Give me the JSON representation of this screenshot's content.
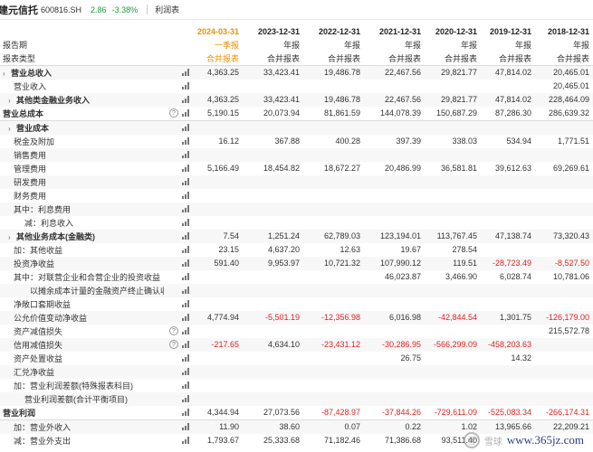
{
  "header": {
    "company_name": "建元信托",
    "stock_code": "600816.SH",
    "price": "2.86",
    "change_pct": "-3.38%",
    "tab": "利润表"
  },
  "columns": {
    "dates": [
      "2024-03-31",
      "2023-12-31",
      "2022-12-31",
      "2021-12-31",
      "2020-12-31",
      "2019-12-31",
      "2018-12-31"
    ],
    "report_periods": [
      "一季报",
      "年报",
      "年报",
      "年报",
      "年报",
      "年报",
      "年报"
    ],
    "report_types": [
      "合并报表",
      "合并报表",
      "合并报表",
      "合并报表",
      "合并报表",
      "合并报表",
      "合并报表"
    ]
  },
  "labels": {
    "report_period": "报告期",
    "report_type": "报表类型"
  },
  "rows": [
    {
      "label": "营业总收入",
      "indent": 0,
      "expand": true,
      "bold": true,
      "help": false,
      "values": [
        "4,363.25",
        "33,423.41",
        "19,486.78",
        "22,467.56",
        "29,821.77",
        "47,814.02",
        "20,465.01"
      ]
    },
    {
      "label": "营业收入",
      "indent": 2,
      "expand": false,
      "bold": false,
      "help": false,
      "values": [
        "",
        "",
        "",
        "",
        "",
        "",
        "20,465.01"
      ]
    },
    {
      "label": "其他类金融业务收入",
      "indent": 1,
      "expand": true,
      "bold": true,
      "help": false,
      "values": [
        "4,363.25",
        "33,423.41",
        "19,486.78",
        "22,467.56",
        "29,821.77",
        "47,814.02",
        "228,464.09"
      ]
    },
    {
      "label": "营业总成本",
      "indent": 0,
      "expand": false,
      "bold": true,
      "help": true,
      "sep": true,
      "values": [
        "5,190.15",
        "20,073.94",
        "81,861.59",
        "144,078.39",
        "150,687.29",
        "87,286.30",
        "286,639.32"
      ]
    },
    {
      "label": "营业成本",
      "indent": 1,
      "expand": true,
      "bold": true,
      "help": false,
      "values": [
        "",
        "",
        "",
        "",
        "",
        "",
        ""
      ]
    },
    {
      "label": "税金及附加",
      "indent": 2,
      "expand": false,
      "bold": false,
      "help": false,
      "values": [
        "16.12",
        "367.88",
        "400.28",
        "397.39",
        "338.03",
        "534.94",
        "1,771.51"
      ]
    },
    {
      "label": "销售费用",
      "indent": 2,
      "expand": false,
      "bold": false,
      "help": false,
      "values": [
        "",
        "",
        "",
        "",
        "",
        "",
        ""
      ]
    },
    {
      "label": "管理费用",
      "indent": 2,
      "expand": false,
      "bold": false,
      "help": false,
      "values": [
        "5,166.49",
        "18,454.82",
        "18,672.27",
        "20,486.99",
        "36,581.81",
        "39,612.63",
        "69,269.61"
      ]
    },
    {
      "label": "研发费用",
      "indent": 2,
      "expand": false,
      "bold": false,
      "help": false,
      "values": [
        "",
        "",
        "",
        "",
        "",
        "",
        ""
      ]
    },
    {
      "label": "财务费用",
      "indent": 2,
      "expand": false,
      "bold": false,
      "help": false,
      "values": [
        "",
        "",
        "",
        "",
        "",
        "",
        ""
      ]
    },
    {
      "label": "其中：利息费用",
      "indent": 2,
      "expand": false,
      "bold": false,
      "help": false,
      "values": [
        "",
        "",
        "",
        "",
        "",
        "",
        ""
      ]
    },
    {
      "label": "减：利息收入",
      "indent": 4,
      "expand": false,
      "bold": false,
      "help": false,
      "values": [
        "",
        "",
        "",
        "",
        "",
        "",
        ""
      ]
    },
    {
      "label": "其他业务成本(金融类)",
      "indent": 1,
      "expand": true,
      "bold": true,
      "help": false,
      "values": [
        "7.54",
        "1,251.24",
        "62,789.03",
        "123,194.01",
        "113,767.45",
        "47,138.74",
        "73,320.43"
      ]
    },
    {
      "label": "加：其他收益",
      "indent": 2,
      "expand": false,
      "bold": false,
      "help": false,
      "values": [
        "23.15",
        "4,637.20",
        "12.63",
        "19.67",
        "278.54",
        "",
        ""
      ]
    },
    {
      "label": "投资净收益",
      "indent": 2,
      "expand": false,
      "bold": false,
      "help": false,
      "values": [
        "591.40",
        "9,953.97",
        "10,721.32",
        "107,990.12",
        "119.51",
        "-28,723.49",
        "-8,527.50"
      ]
    },
    {
      "label": "其中：对联营企业和合营企业的投资收益",
      "indent": 2,
      "expand": false,
      "bold": false,
      "help": false,
      "values": [
        "",
        "",
        "",
        "46,023.87",
        "3,466.90",
        "6,028.74",
        "10,781.06"
      ]
    },
    {
      "label": "以摊余成本计量的金融资产终止确认收益",
      "indent": 5,
      "expand": false,
      "bold": false,
      "help": false,
      "values": [
        "",
        "",
        "",
        "",
        "",
        "",
        ""
      ]
    },
    {
      "label": "净敞口套期收益",
      "indent": 2,
      "expand": false,
      "bold": false,
      "help": false,
      "values": [
        "",
        "",
        "",
        "",
        "",
        "",
        ""
      ]
    },
    {
      "label": "公允价值变动净收益",
      "indent": 2,
      "expand": false,
      "bold": false,
      "help": false,
      "values": [
        "4,774.94",
        "-5,501.19",
        "-12,356.98",
        "6,016.98",
        "-42,844.54",
        "1,301.75",
        "-126,179.00"
      ]
    },
    {
      "label": "资产减值损失",
      "indent": 2,
      "expand": false,
      "bold": false,
      "help": true,
      "values": [
        "",
        "",
        "",
        "",
        "",
        "",
        "215,572.78"
      ]
    },
    {
      "label": "信用减值损失",
      "indent": 2,
      "expand": false,
      "bold": false,
      "help": true,
      "values": [
        "-217.65",
        "4,634.10",
        "-23,431.12",
        "-30,286.95",
        "-566,299.09",
        "-458,203.63",
        ""
      ]
    },
    {
      "label": "资产处置收益",
      "indent": 2,
      "expand": false,
      "bold": false,
      "help": false,
      "values": [
        "",
        "",
        "",
        "26.75",
        "",
        "14.32",
        ""
      ]
    },
    {
      "label": "汇兑净收益",
      "indent": 2,
      "expand": false,
      "bold": false,
      "help": false,
      "values": [
        "",
        "",
        "",
        "",
        "",
        "",
        ""
      ]
    },
    {
      "label": "加：营业利润差额(特殊报表科目)",
      "indent": 2,
      "expand": false,
      "bold": false,
      "help": false,
      "values": [
        "",
        "",
        "",
        "",
        "",
        "",
        ""
      ]
    },
    {
      "label": "营业利润差额(合计平衡项目)",
      "indent": 4,
      "expand": false,
      "bold": false,
      "help": false,
      "values": [
        "",
        "",
        "",
        "",
        "",
        "",
        ""
      ]
    },
    {
      "label": "营业利润",
      "indent": 0,
      "expand": false,
      "bold": true,
      "help": false,
      "sep": true,
      "values": [
        "4,344.94",
        "27,073.56",
        "-87,428.97",
        "-37,844.26",
        "-729,611.09",
        "-525,083.34",
        "-266,174.31"
      ]
    },
    {
      "label": "加：营业外收入",
      "indent": 2,
      "expand": false,
      "bold": false,
      "help": false,
      "values": [
        "11.90",
        "38.60",
        "0.07",
        "0.22",
        "1.02",
        "13,965.66",
        "22,209.21"
      ]
    },
    {
      "label": "减：营业外支出",
      "indent": 2,
      "expand": false,
      "bold": false,
      "help": false,
      "values": [
        "1,793.67",
        "25,333.68",
        "71,182.46",
        "71,386.68",
        "93,511.40",
        "",
        ""
      ]
    }
  ],
  "watermark": {
    "logo_glyph": "雪",
    "brand": "雪球",
    "site": "www.365jz.com"
  }
}
